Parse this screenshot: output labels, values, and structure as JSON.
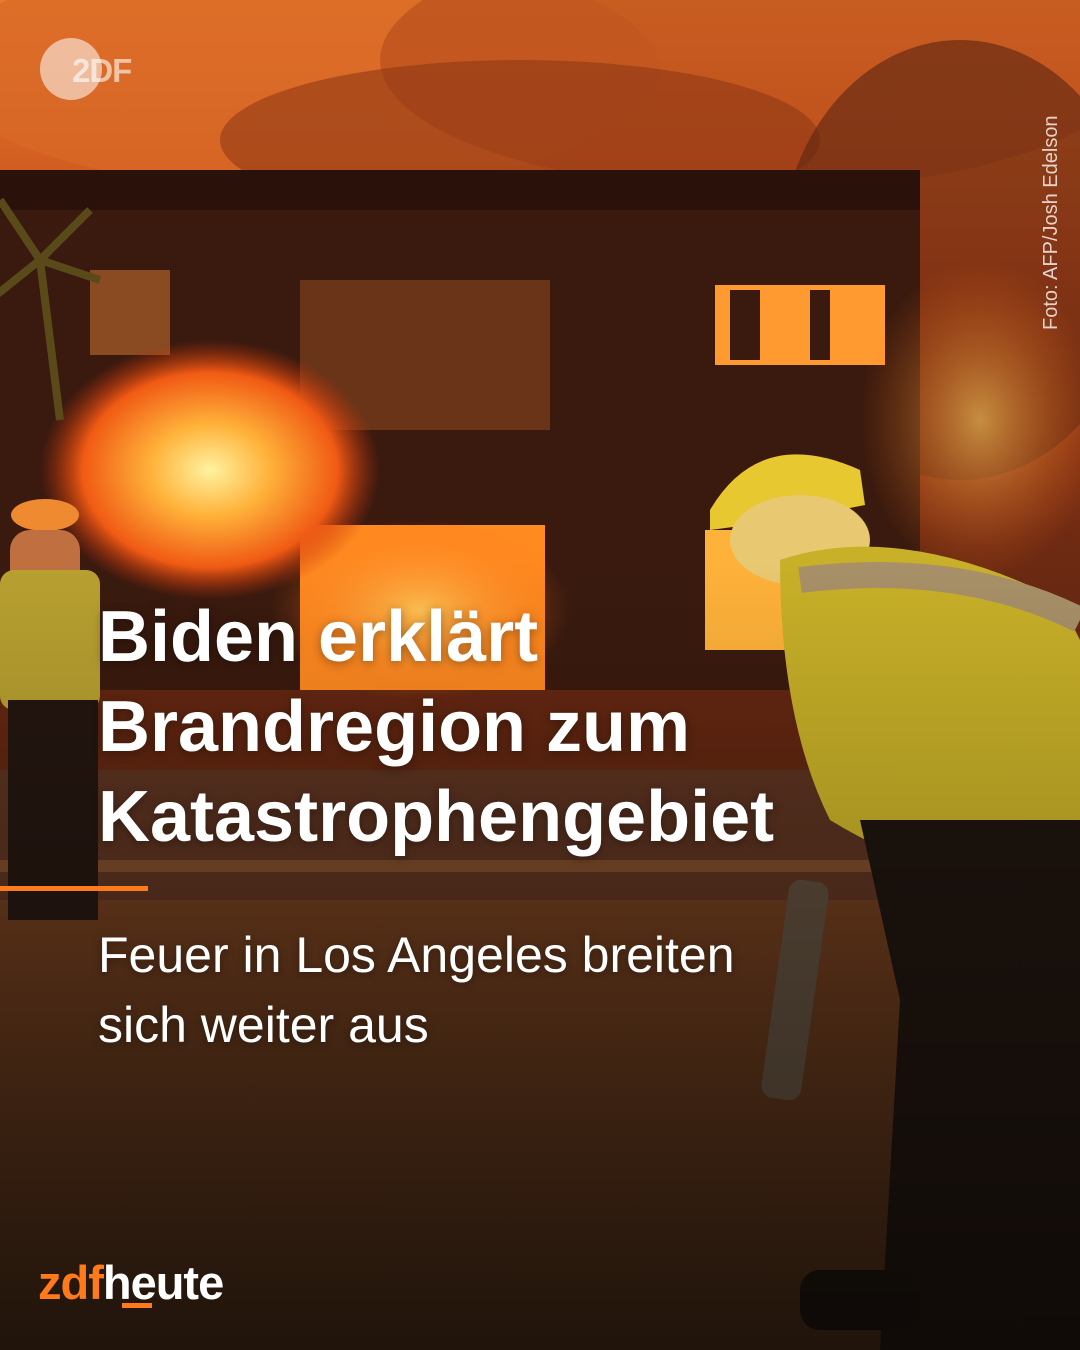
{
  "watermark": {
    "text": "2DF"
  },
  "photo_credit": "Foto: AFP/Josh Edelson",
  "headline": {
    "line1": "Biden erklärt",
    "line2": "Brandregion zum",
    "line3": "Katastrophengebiet"
  },
  "subline": {
    "line1": "Feuer in Los Angeles breiten",
    "line2": "sich weiter aus"
  },
  "brand": {
    "part1": "zdf",
    "part2": "heute"
  },
  "colors": {
    "accent": "#ff7a1a",
    "text": "#ffffff"
  }
}
